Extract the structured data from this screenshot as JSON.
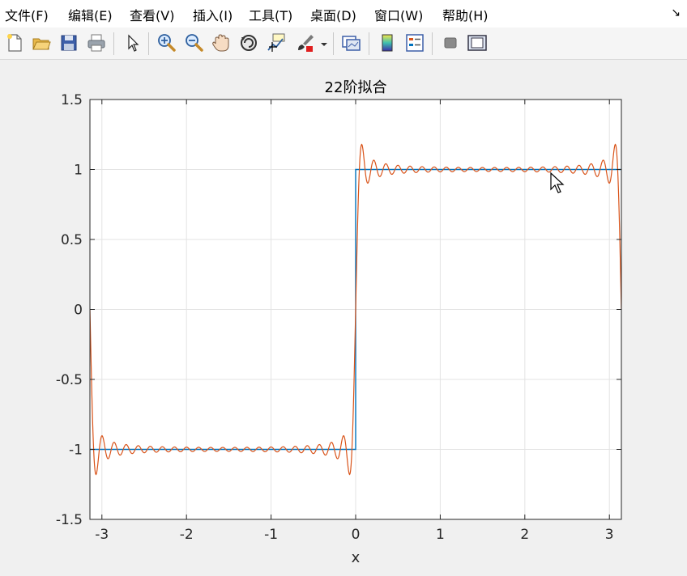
{
  "menu": {
    "items": [
      {
        "label": "文件(F)"
      },
      {
        "label": "编辑(E)"
      },
      {
        "label": "查看(V)"
      },
      {
        "label": "插入(I)"
      },
      {
        "label": "工具(T)"
      },
      {
        "label": "桌面(D)"
      },
      {
        "label": "窗口(W)"
      },
      {
        "label": "帮助(H)"
      }
    ],
    "pin_glyph": "↘"
  },
  "toolbar": {
    "buttons": [
      "new-file-icon",
      "open-folder-icon",
      "save-icon",
      "print-icon",
      "select-arrow-icon",
      "zoom-in-icon",
      "zoom-out-icon",
      "pan-hand-icon",
      "rotate-3d-icon",
      "data-cursor-icon",
      "brush-icon",
      "link-plot-icon",
      "colorbar-icon",
      "legend-icon",
      "hide-plot-tools-icon",
      "show-plot-tools-icon"
    ]
  },
  "colors": {
    "square_wave": "#0072bd",
    "fourier_fit": "#d95319",
    "grid": "#e3e3e3",
    "axes": "#262626"
  },
  "chart_data": {
    "type": "line",
    "title": "22阶拟合",
    "xlabel": "x",
    "ylabel": "",
    "xlim": [
      -3.14159,
      3.14159
    ],
    "ylim": [
      -1.5,
      1.5
    ],
    "xticks": [
      -3,
      -2,
      -1,
      0,
      1,
      2,
      3
    ],
    "xtick_labels": [
      "-3",
      "-2",
      "-1",
      "0",
      "1",
      "2",
      "3"
    ],
    "yticks": [
      -1.5,
      -1,
      -0.5,
      0,
      0.5,
      1,
      1.5
    ],
    "ytick_labels": [
      "-1.5",
      "-1",
      "-0.5",
      "0",
      "0.5",
      "1",
      "1.5"
    ],
    "grid": true,
    "series": [
      {
        "kind": "square_wave",
        "x": [
          -3.14159,
          0,
          0,
          3.14159
        ],
        "y": [
          -1,
          -1,
          1,
          1
        ]
      },
      {
        "kind": "fourier_partial_sum",
        "harmonics": [
          1,
          3,
          5,
          7,
          9,
          11,
          13,
          15,
          17,
          19,
          21,
          23,
          25,
          27,
          29,
          31,
          33,
          35,
          37,
          39,
          41,
          43
        ]
      }
    ]
  }
}
